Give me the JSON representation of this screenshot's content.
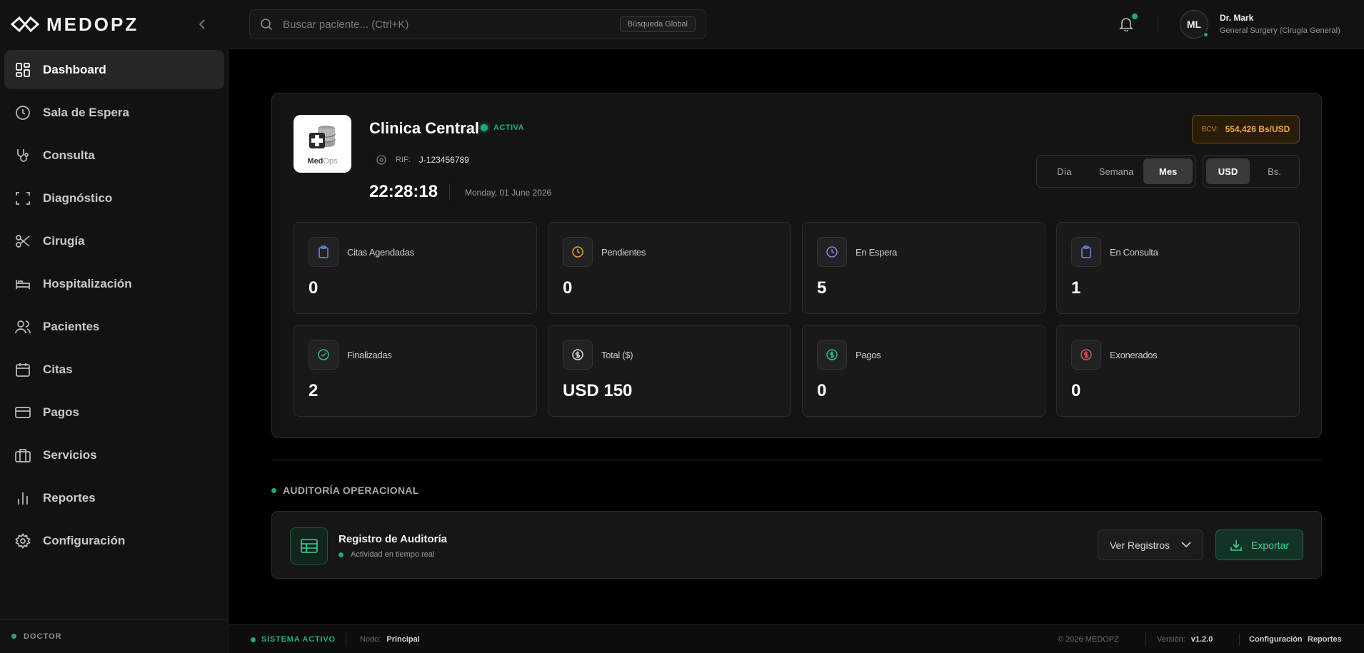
{
  "app": {
    "name": "MEDOPZ"
  },
  "sidebar": {
    "items": [
      {
        "label": "Dashboard",
        "icon": "dashboard-icon",
        "active": true
      },
      {
        "label": "Sala de Espera",
        "icon": "clock-icon"
      },
      {
        "label": "Consulta",
        "icon": "stethoscope-icon"
      },
      {
        "label": "Diagnóstico",
        "icon": "scan-icon"
      },
      {
        "label": "Cirugía",
        "icon": "scissors-icon"
      },
      {
        "label": "Hospitalización",
        "icon": "bed-icon"
      },
      {
        "label": "Pacientes",
        "icon": "users-icon"
      },
      {
        "label": "Citas",
        "icon": "calendar-icon"
      },
      {
        "label": "Pagos",
        "icon": "credit-card-icon"
      },
      {
        "label": "Servicios",
        "icon": "briefcase-icon"
      },
      {
        "label": "Reportes",
        "icon": "bar-chart-icon"
      },
      {
        "label": "Configuración",
        "icon": "gear-icon"
      }
    ],
    "role": "DOCTOR"
  },
  "topbar": {
    "search_placeholder": "Buscar paciente... (Ctrl+K)",
    "search_scope": "Búsqueda Global",
    "user": {
      "initials": "ML",
      "name": "Dr. Mark",
      "role": "General Surgery (Cirugía General)"
    }
  },
  "clinic": {
    "logo_brand_a": "Med",
    "logo_brand_b": "Ops",
    "name": "Clinica Central",
    "status": "ACTIVA",
    "rif_label": "RIF:",
    "rif": "J-123456789",
    "time": "22:28:18",
    "date": "Monday, 01 June 2026",
    "bcv_label": "BCV:",
    "bcv_value": "554,426 Bs/USD"
  },
  "period": {
    "options": [
      "Día",
      "Semana",
      "Mes"
    ],
    "selected": "Mes"
  },
  "currency": {
    "options": [
      "USD",
      "Bs."
    ],
    "selected": "USD"
  },
  "stats": [
    {
      "label": "Citas Agendadas",
      "value": "0",
      "icon": "clipboard-icon",
      "color": "#5b8def"
    },
    {
      "label": "Pendientes",
      "value": "0",
      "icon": "clock-icon",
      "color": "#e0a030"
    },
    {
      "label": "En Espera",
      "value": "5",
      "icon": "clock-icon",
      "color": "#9a7ce0"
    },
    {
      "label": "En Consulta",
      "value": "1",
      "icon": "clipboard-icon",
      "color": "#6f86ef"
    },
    {
      "label": "Finalizadas",
      "value": "2",
      "icon": "check-circle-icon",
      "color": "#2fbf80"
    },
    {
      "label": "Total ($)",
      "value": "USD 150",
      "icon": "dollar-icon",
      "color": "#d8d8d8"
    },
    {
      "label": "Pagos",
      "value": "0",
      "icon": "dollar-icon",
      "color": "#2fbf80"
    },
    {
      "label": "Exonerados",
      "value": "0",
      "icon": "dollar-icon",
      "color": "#e05555"
    }
  ],
  "audit": {
    "section_title": "AUDITORÍA OPERACIONAL",
    "title": "Registro de Auditoría",
    "subtitle": "Actividad en tiempo real",
    "view_label": "Ver Registros",
    "export_label": "Exportar"
  },
  "footer": {
    "system_status": "SISTEMA ACTIVO",
    "node_label": "Nodo:",
    "node_value": "Principal",
    "copyright": "© 2026 MEDOPZ",
    "version_label": "Versión:",
    "version_value": "v1.2.0",
    "link_config": "Configuración",
    "link_reports": "Reportes"
  }
}
